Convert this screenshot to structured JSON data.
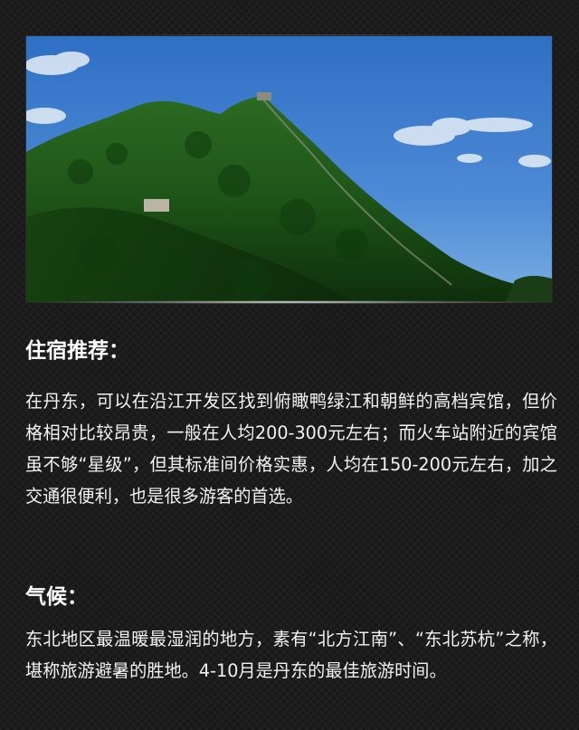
{
  "photo": {
    "subject": "great-wall-mountain-photo"
  },
  "lodging": {
    "heading": "住宿推荐：",
    "body": "在丹东，可以在沿江开发区找到俯瞰鸭绿江和朝鲜的高档宾馆，但价格相对比较昂贵，一般在人均200-300元左右；而火车站附近的宾馆虽不够“星级”，但其标准间价格实惠，人均在150-200元左右，加之交通很便利，也是很多游客的首选。"
  },
  "climate": {
    "heading": "气候：",
    "body": "东北地区最温暖最湿润的地方，素有“北方江南”、“东北苏杭”之称，堪称旅游避暑的胜地。4-10月是丹东的最佳旅游时间。"
  },
  "colors": {
    "background": "#1c1c1c",
    "text": "#ffffff",
    "sky": "#3f7fd0",
    "forest": "#1f5a1c"
  }
}
